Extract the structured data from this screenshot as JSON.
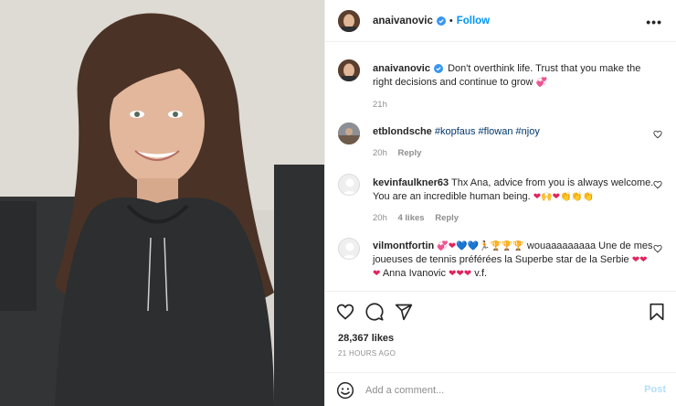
{
  "post": {
    "username": "anaivanovic",
    "follow_label": "Follow",
    "more_label": "•••",
    "verified_icon": "verified-badge-icon",
    "accent": "#0095f6"
  },
  "caption": {
    "username": "anaivanovic",
    "text": "Don't overthink life. Trust that you make the right decisions and continue to grow",
    "emoji": "💞",
    "time": "21h"
  },
  "comments": [
    {
      "username": "etblondsche",
      "text": "#kopfaus #flowan #njoy",
      "time": "20h",
      "reply_label": "Reply"
    },
    {
      "username": "kevinfaulkner63",
      "text": "Thx Ana, advice from you is always welcome. You are an incredible human being.",
      "emoji": "❤🙌❤👏👏👏",
      "time": "20h",
      "likes": "4 likes",
      "reply_label": "Reply"
    },
    {
      "username": "vilmontfortin",
      "emoji_lead": "💞❤💙💙🏃🏆🏆🏆",
      "text": "wouaaaaaaaaa Une de mes joueuses de tennis préférées la Superbe star de la Serbie",
      "emoji_mid": "❤❤",
      "emoji_start2": "❤",
      "text2": "Anna Ivanovic",
      "emoji_end": "❤❤❤",
      "text3": "v.f."
    }
  ],
  "stats": {
    "likes": "28,367 likes",
    "ago": "21 HOURS AGO"
  },
  "composer": {
    "placeholder": "Add a comment...",
    "post_label": "Post"
  }
}
